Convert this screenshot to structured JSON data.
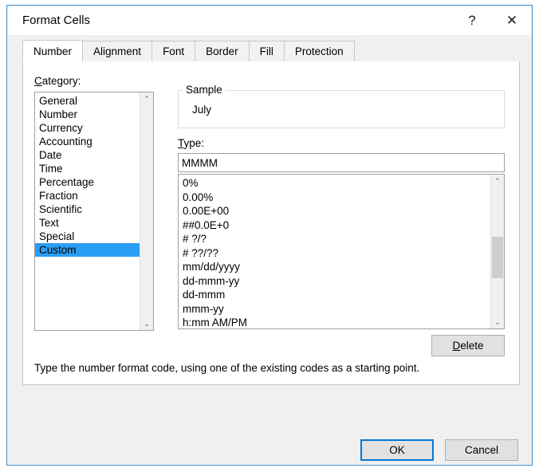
{
  "window": {
    "title": "Format Cells",
    "help_icon": "?",
    "close_icon": "✕"
  },
  "tabs": [
    {
      "label": "Number",
      "active": true
    },
    {
      "label": "Alignment",
      "active": false
    },
    {
      "label": "Font",
      "active": false
    },
    {
      "label": "Border",
      "active": false
    },
    {
      "label": "Fill",
      "active": false
    },
    {
      "label": "Protection",
      "active": false
    }
  ],
  "category": {
    "label_prefix": "C",
    "label_rest": "ategory:",
    "items": [
      {
        "label": "General",
        "selected": false
      },
      {
        "label": "Number",
        "selected": false
      },
      {
        "label": "Currency",
        "selected": false
      },
      {
        "label": "Accounting",
        "selected": false
      },
      {
        "label": "Date",
        "selected": false
      },
      {
        "label": "Time",
        "selected": false
      },
      {
        "label": "Percentage",
        "selected": false
      },
      {
        "label": "Fraction",
        "selected": false
      },
      {
        "label": "Scientific",
        "selected": false
      },
      {
        "label": "Text",
        "selected": false
      },
      {
        "label": "Special",
        "selected": false
      },
      {
        "label": "Custom",
        "selected": true
      }
    ],
    "scroll_up_icon": "⌃",
    "scroll_down_icon": "⌄"
  },
  "sample": {
    "legend": "Sample",
    "value": "July"
  },
  "type": {
    "label_prefix": "T",
    "label_rest": "ype:",
    "value": "MMMM",
    "placeholder": "",
    "items": [
      "0%",
      "0.00%",
      "0.00E+00",
      "##0.0E+0",
      "# ?/?",
      "# ??/??",
      "mm/dd/yyyy",
      "dd-mmm-yy",
      "dd-mmm",
      "mmm-yy",
      "h:mm AM/PM"
    ],
    "scroll_up_icon": "⌃",
    "scroll_down_icon": "⌄"
  },
  "buttons": {
    "delete_prefix": "D",
    "delete_rest": "elete",
    "ok": "OK",
    "cancel": "Cancel"
  },
  "hint": "Type the number format code, using one of the existing codes as a starting point.",
  "colors": {
    "accent": "#0078d7",
    "selection": "#2a9df4",
    "dialog_border": "#3b8ed0",
    "panel_bg": "#f0f0f0",
    "button_face": "#e1e1e1"
  }
}
